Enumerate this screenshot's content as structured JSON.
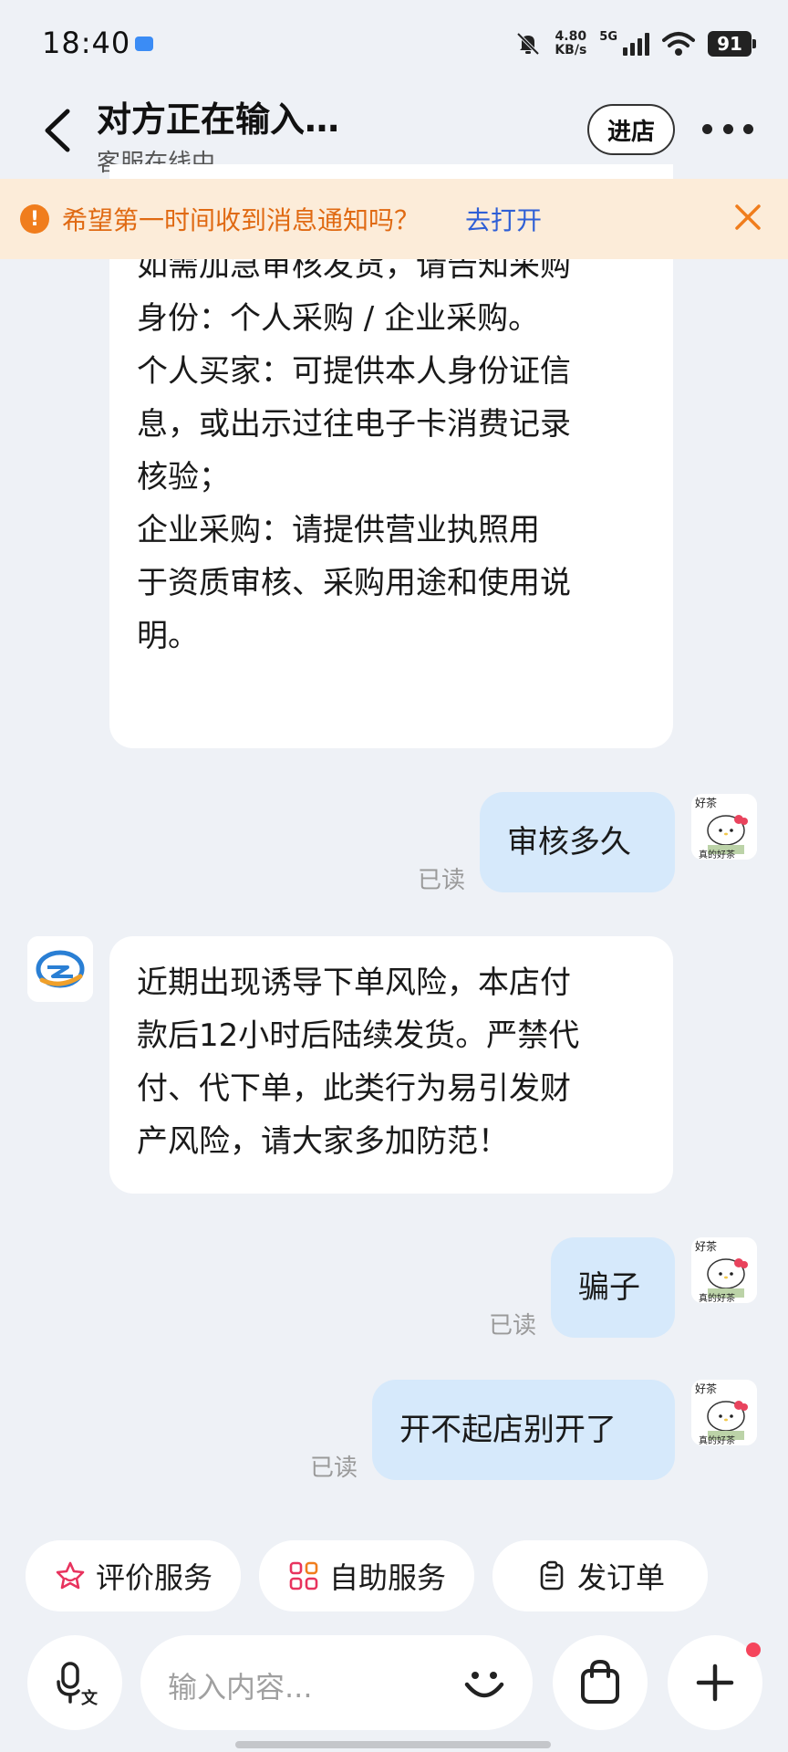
{
  "status_bar": {
    "time": "18:40",
    "net_speed_value": "4.80",
    "net_speed_unit": "KB/s",
    "network": "5G",
    "battery": "91"
  },
  "header": {
    "title": "对方正在输入…",
    "subtitle": "客服在线中",
    "enter_store": "进店"
  },
  "notice": {
    "text": "希望第一时间收到消息通知吗？",
    "link": "去打开"
  },
  "messages": {
    "m1_lines": "位买家提高警惕。\n如需加急审核发货，请告知采购\n身份：个人采购 / 企业采购。\n个人买家：可提供本人身份证信\n息，或出示过往电子卡消费记录\n核验；\n企业采购：请提供营业执照用\n于资质审核、采购用途和使用说\n明。",
    "m2": "审核多久",
    "m2_status": "已读",
    "m3_lines": "近期出现诱导下单风险，本店付\n款后12小时后陆续发货。严禁代\n付、代下单，此类行为易引发财\n产风险，请大家多加防范！",
    "m4": "骗子",
    "m4_status": "已读",
    "m5": "开不起店别开了",
    "m5_status": "已读"
  },
  "avatar_text": {
    "top": "好茶",
    "bottom": "真的好茶"
  },
  "quick_actions": [
    {
      "label": "评价服务",
      "icon": "star-icon"
    },
    {
      "label": "自助服务",
      "icon": "grid-icon"
    },
    {
      "label": "发订单",
      "icon": "clipboard-icon"
    }
  ],
  "input": {
    "placeholder": "输入内容..."
  },
  "colors": {
    "accent_orange": "#f07d1d",
    "link_blue": "#2f5fd6",
    "my_bubble": "#d6e9fb",
    "badge_red": "#f5455c"
  }
}
